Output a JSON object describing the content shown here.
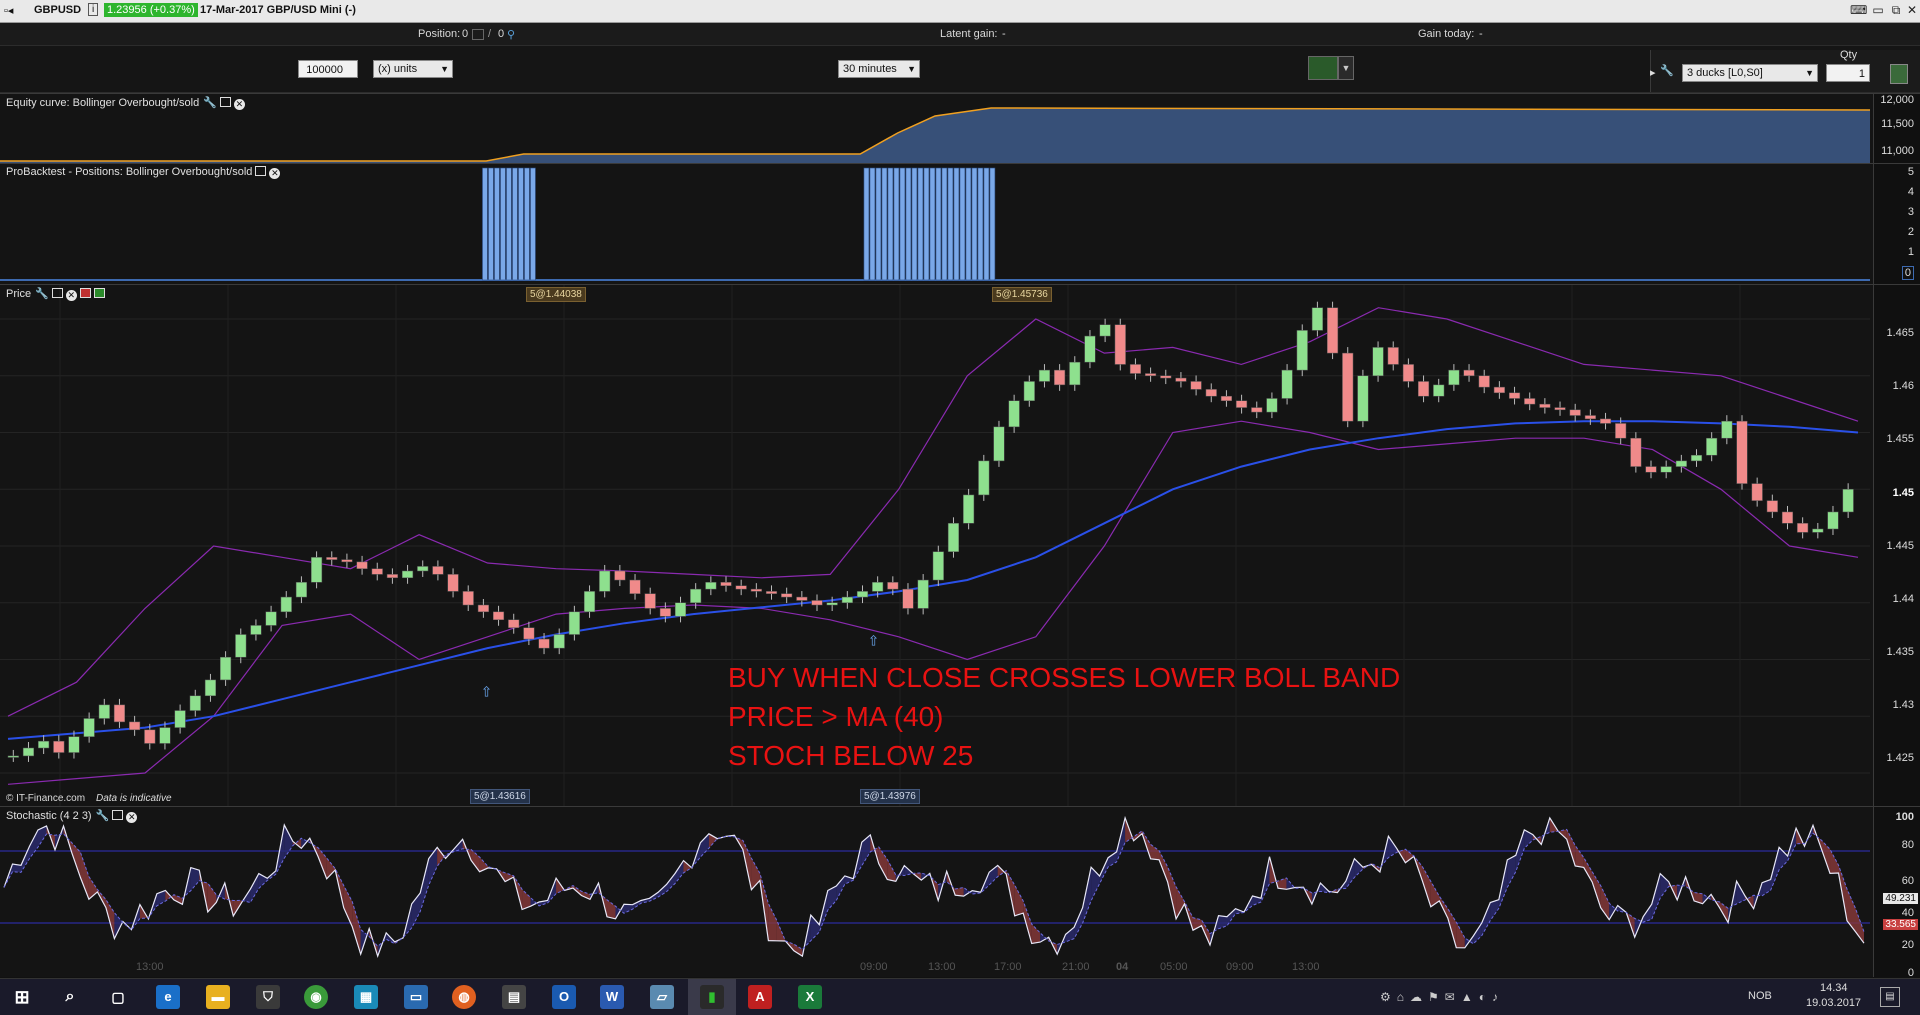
{
  "title_bar": {
    "symbol": "GBPUSD",
    "info_icon": "i",
    "price_change": "1.23956 (+0.37%)",
    "instrument": "17-Mar-2017 GBP/USD Mini (-)"
  },
  "info_bar": {
    "position_label": "Position:",
    "position_value": "0",
    "position_value2": "0",
    "latent_label": "Latent gain:",
    "latent_value": "-",
    "gain_today_label": "Gain today:",
    "gain_today_value": "-"
  },
  "toolbar": {
    "quantity_value": "100000",
    "units_value": "(x) units",
    "timeframe_value": "30 minutes",
    "strategy_value": "3 ducks [L0,S0]",
    "qty_label": "Qty",
    "qty_value": "1"
  },
  "panels": {
    "equity": {
      "label": "Equity curve: Bollinger Overbought/sold",
      "ticks": [
        "12,000",
        "11,500",
        "11,000"
      ]
    },
    "positions": {
      "label": "ProBacktest - Positions: Bollinger Overbought/sold",
      "ticks": [
        "5",
        "4",
        "3",
        "2",
        "1",
        "0"
      ]
    },
    "price": {
      "label": "Price",
      "ticks": [
        "1.465",
        "1.46",
        "1.455",
        "1.45",
        "1.445",
        "1.44",
        "1.435",
        "1.43",
        "1.425"
      ],
      "tag_top_1": "5@1.44038",
      "tag_top_2": "5@1.45736",
      "tag_bottom_1": "5@1.43616",
      "tag_bottom_2": "5@1.43976",
      "copyright": "© IT-Finance.com",
      "indicative": "Data is indicative",
      "annotation": [
        "BUY WHEN CLOSE CROSSES LOWER BOLL BAND",
        "PRICE > MA (40)",
        "STOCH BELOW 25"
      ]
    },
    "stochastic": {
      "label": "Stochastic (4 2 3)",
      "ticks": [
        "100",
        "80",
        "60",
        "40",
        "20",
        "0"
      ],
      "value_k": "49.231",
      "value_d": "33.565"
    }
  },
  "time_axis": [
    "13:00",
    "09:00",
    "13:00",
    "17:00",
    "21:00",
    "04",
    "05:00",
    "09:00",
    "13:00"
  ],
  "taskbar": {
    "clock_time": "14.34",
    "clock_date": "19.03.2017",
    "language": "NOB"
  },
  "chart_data": {
    "type": "line",
    "price_scale": [
      1.422,
      1.468
    ],
    "close": [
      1.4265,
      1.4272,
      1.4278,
      1.4268,
      1.4282,
      1.4298,
      1.431,
      1.4295,
      1.4288,
      1.4276,
      1.429,
      1.4305,
      1.4318,
      1.4332,
      1.4352,
      1.4372,
      1.438,
      1.4392,
      1.4405,
      1.4418,
      1.444,
      1.4438,
      1.4436,
      1.443,
      1.4425,
      1.4422,
      1.4428,
      1.4432,
      1.4425,
      1.441,
      1.4398,
      1.4392,
      1.4385,
      1.4378,
      1.4368,
      1.436,
      1.4372,
      1.4392,
      1.441,
      1.4428,
      1.442,
      1.4408,
      1.4395,
      1.4388,
      1.44,
      1.4412,
      1.4418,
      1.4415,
      1.4412,
      1.441,
      1.4408,
      1.4405,
      1.4402,
      1.4398,
      1.44,
      1.4405,
      1.441,
      1.4418,
      1.4412,
      1.4395,
      1.442,
      1.4445,
      1.447,
      1.4495,
      1.4525,
      1.4555,
      1.4578,
      1.4595,
      1.4605,
      1.4592,
      1.4612,
      1.4635,
      1.4645,
      1.461,
      1.4602,
      1.46,
      1.4598,
      1.4595,
      1.4588,
      1.4582,
      1.4578,
      1.4572,
      1.4568,
      1.458,
      1.4605,
      1.464,
      1.466,
      1.462,
      1.456,
      1.46,
      1.4625,
      1.461,
      1.4595,
      1.4582,
      1.4592,
      1.4605,
      1.46,
      1.459,
      1.4585,
      1.458,
      1.4575,
      1.4572,
      1.457,
      1.4565,
      1.4562,
      1.4558,
      1.4545,
      1.452,
      1.4515,
      1.452,
      1.4525,
      1.453,
      1.4545,
      1.456,
      1.4505,
      1.449,
      1.448,
      1.447,
      1.4462,
      1.4465,
      1.448,
      1.45
    ],
    "ma": [
      1.428,
      1.4285,
      1.429,
      1.43,
      1.4315,
      1.433,
      1.4345,
      1.436,
      1.4372,
      1.4382,
      1.439,
      1.4396,
      1.4402,
      1.441,
      1.442,
      1.444,
      1.447,
      1.45,
      1.452,
      1.4535,
      1.4545,
      1.4553,
      1.4558,
      1.456,
      1.456,
      1.4558,
      1.4555,
      1.455
    ],
    "bb_upper": [
      1.43,
      1.433,
      1.4395,
      1.445,
      1.444,
      1.443,
      1.446,
      1.4435,
      1.443,
      1.4428,
      1.4425,
      1.4422,
      1.4425,
      1.45,
      1.46,
      1.465,
      1.462,
      1.4625,
      1.461,
      1.463,
      1.466,
      1.465,
      1.463,
      1.461,
      1.4605,
      1.46,
      1.458,
      1.456
    ],
    "bb_lower": [
      1.424,
      1.4245,
      1.425,
      1.43,
      1.438,
      1.439,
      1.435,
      1.437,
      1.439,
      1.4395,
      1.4398,
      1.4395,
      1.4385,
      1.437,
      1.435,
      1.437,
      1.445,
      1.455,
      1.456,
      1.455,
      1.4535,
      1.454,
      1.4545,
      1.4545,
      1.4535,
      1.45,
      1.445,
      1.444
    ],
    "equity": {
      "range": [
        11000,
        12200
      ],
      "steps": [
        [
          0.0,
          10980
        ],
        [
          0.26,
          10980
        ],
        [
          0.28,
          11120
        ],
        [
          0.46,
          11120
        ],
        [
          0.48,
          11540
        ],
        [
          0.5,
          11880
        ],
        [
          0.53,
          12040
        ],
        [
          1.0,
          12000
        ]
      ]
    },
    "positions_blocks": [
      [
        0.258,
        0.286
      ],
      [
        0.462,
        0.53
      ]
    ],
    "stoch_k_seed": 7,
    "stoch_levels": [
      25,
      75
    ]
  }
}
